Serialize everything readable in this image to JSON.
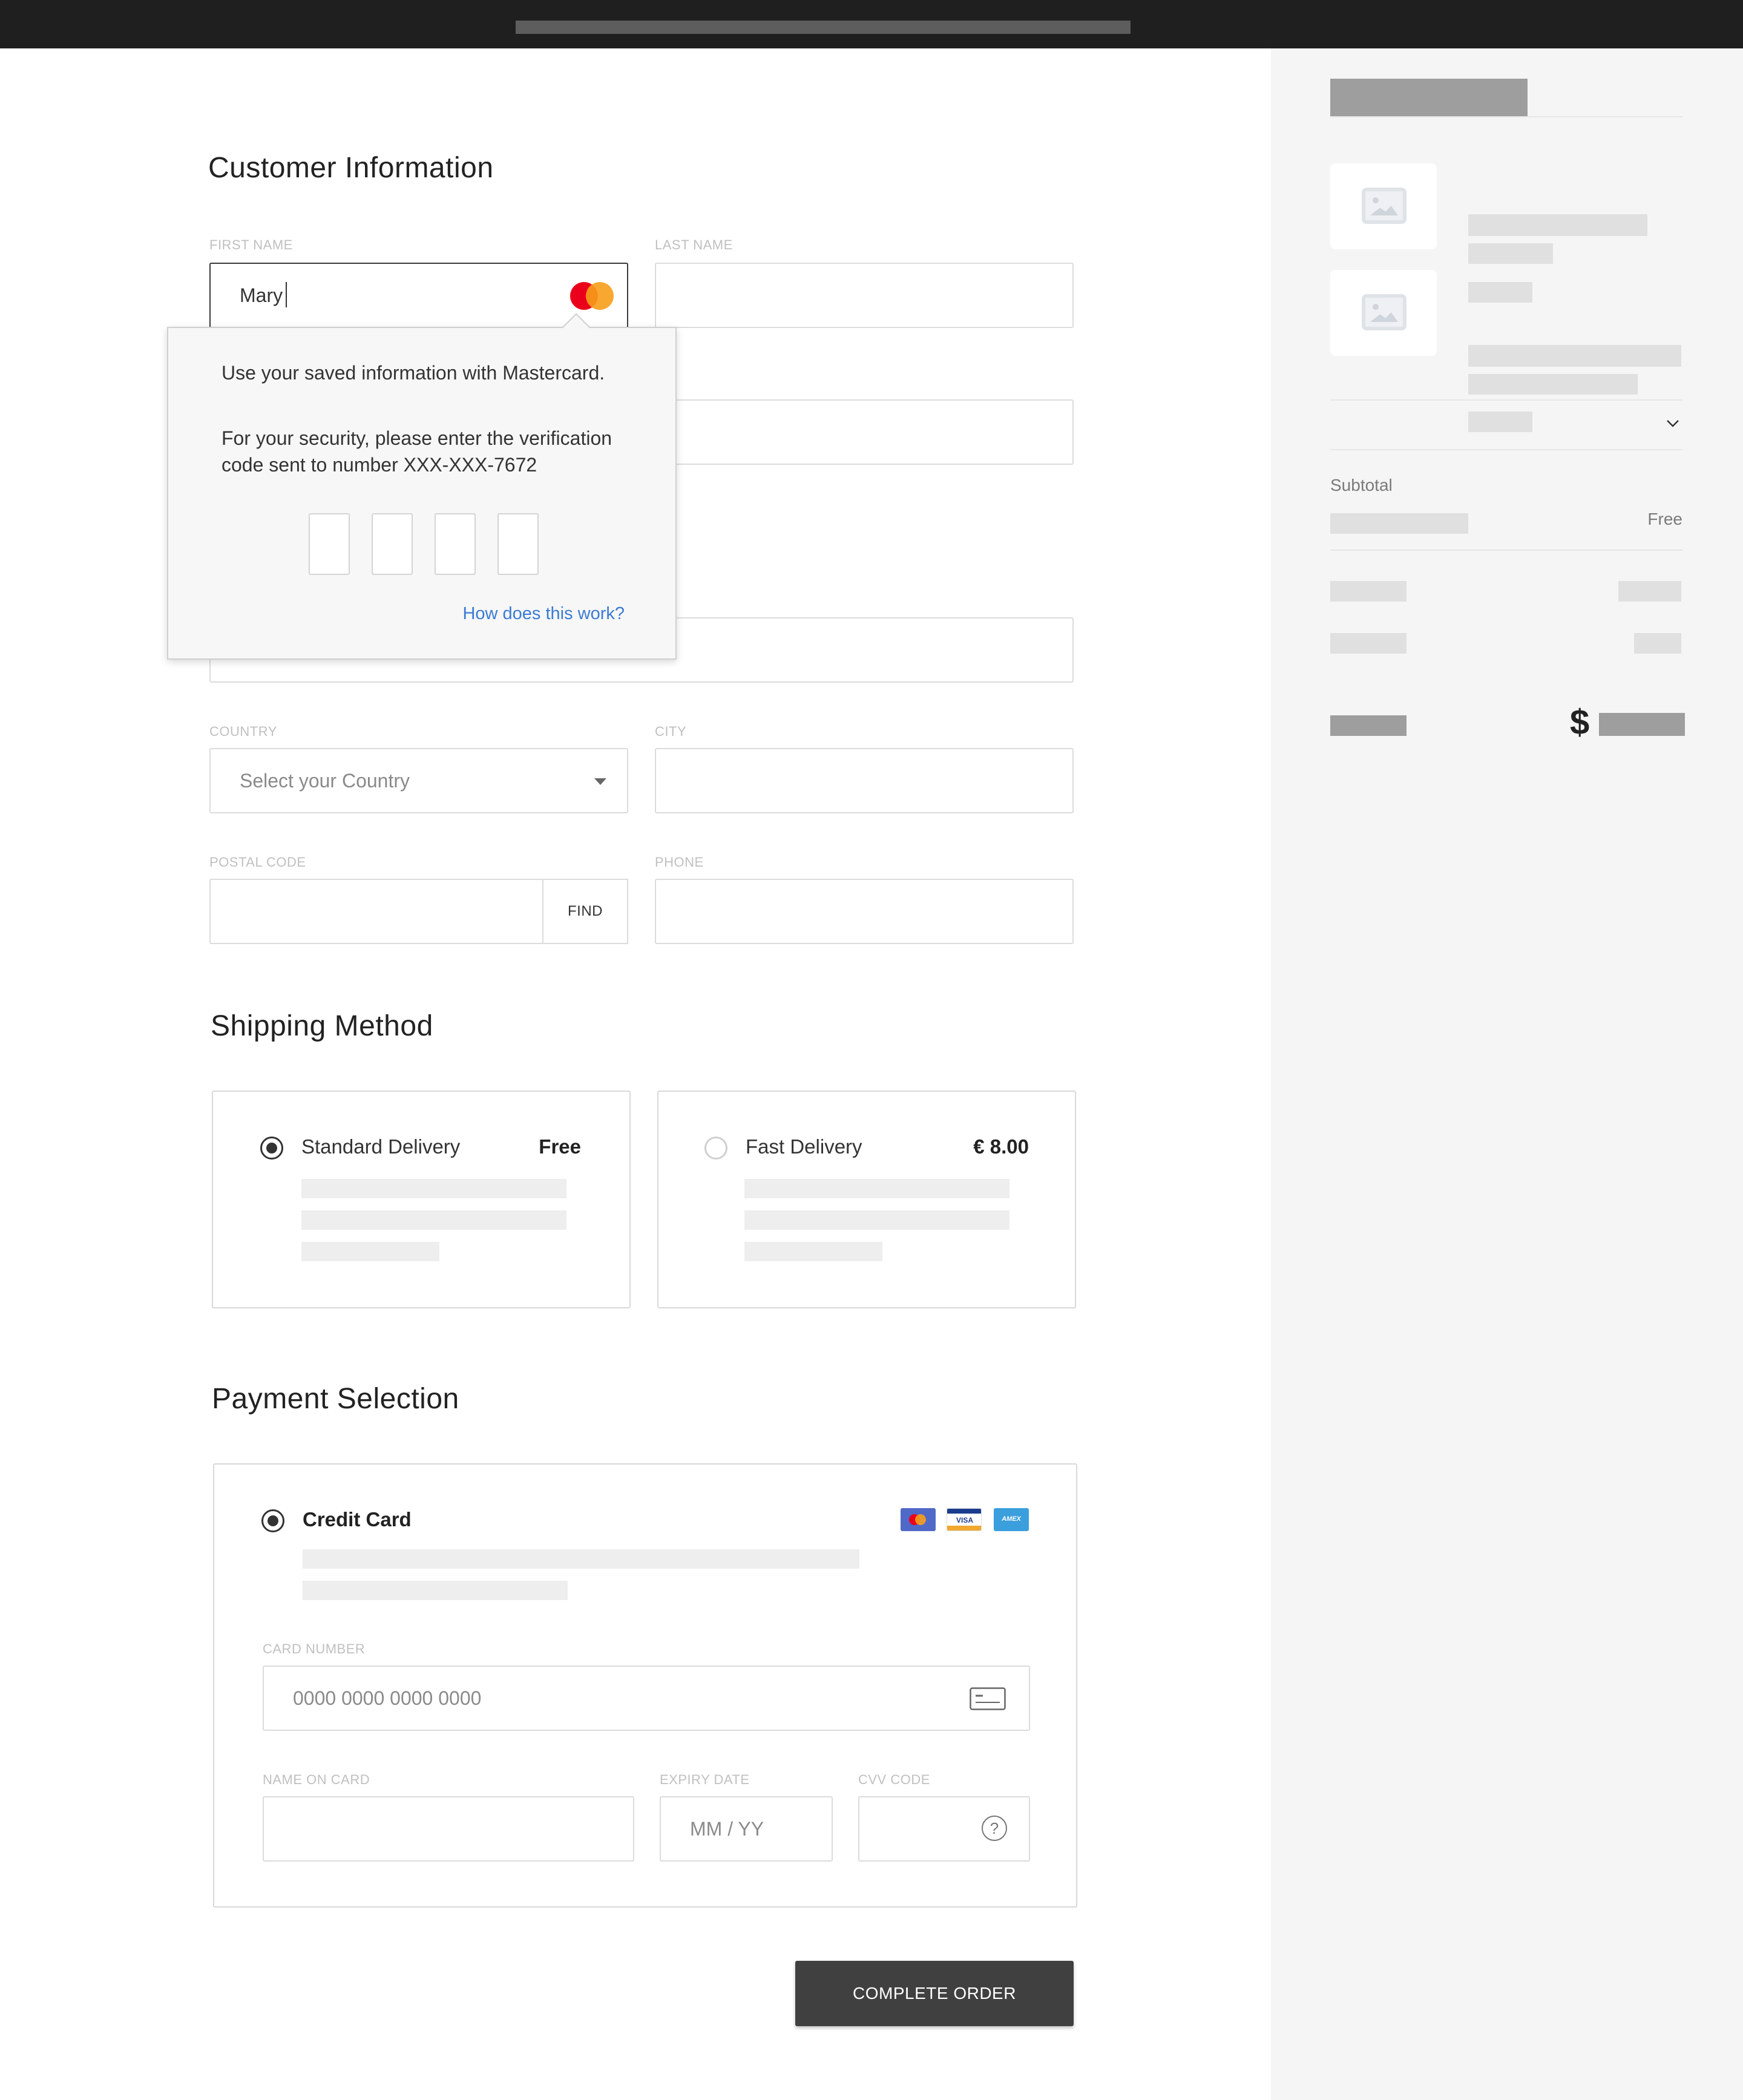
{
  "customer": {
    "heading": "Customer Information",
    "first_name_label": "FIRST NAME",
    "first_name_value": "Mary",
    "last_name_label": "LAST NAME",
    "country_label": "COUNTRY",
    "country_placeholder": "Select your Country",
    "city_label": "CITY",
    "postal_label": "POSTAL CODE",
    "find_label": "FIND",
    "phone_label": "PHONE"
  },
  "popup": {
    "line1": "Use your saved information with Mastercard.",
    "line2": "For your security, please enter the verification code sent to number XXX-XXX-7672",
    "help_link": "How does this work?"
  },
  "shipping": {
    "heading": "Shipping Method",
    "options": [
      {
        "title": "Standard Delivery",
        "price": "Free",
        "selected": true
      },
      {
        "title": "Fast Delivery",
        "price": "€ 8.00",
        "selected": false
      }
    ]
  },
  "payment": {
    "heading": "Payment Selection",
    "method": "Credit Card",
    "card_number_label": "CARD NUMBER",
    "card_number_placeholder": "0000 0000 0000 0000",
    "name_on_card_label": "NAME ON CARD",
    "expiry_label": "EXPIRY DATE",
    "expiry_placeholder": "MM / YY",
    "cvv_label": "CVV CODE",
    "cvv_help_icon": "?",
    "logos": {
      "visa": "VISA",
      "amex": "AMEX"
    }
  },
  "summary": {
    "subtotal_label": "Subtotal",
    "shipping_value": "Free",
    "currency_symbol": "$"
  },
  "actions": {
    "complete_order": "COMPLETE ORDER"
  },
  "colors": {
    "link": "#3b7bd4",
    "primary_button": "#404040",
    "mastercard_red": "#eb001b",
    "mastercard_orange": "#f79e1b"
  }
}
